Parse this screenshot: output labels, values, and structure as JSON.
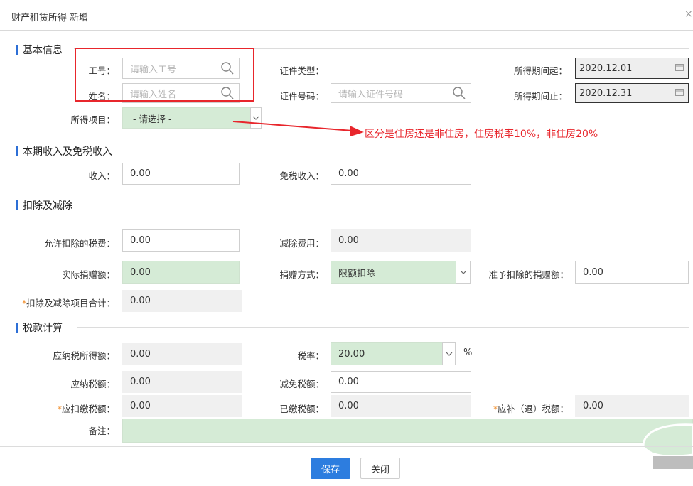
{
  "window": {
    "title": "财产租赁所得 新增",
    "close": "×"
  },
  "sections": {
    "basic": "基本信息",
    "income": "本期收入及免税收入",
    "deduction": "扣除及减除",
    "tax": "税款计算"
  },
  "basic": {
    "emp_no_label": "工号：",
    "emp_no_placeholder": "请输入工号",
    "name_label": "姓名：",
    "name_placeholder": "请输入姓名",
    "id_type_label": "证件类型：",
    "id_no_label": "证件号码：",
    "id_no_placeholder": "请输入证件号码",
    "period_start_label": "所得期间起：",
    "period_start_value": "2020.12.01",
    "period_end_label": "所得期间止：",
    "period_end_value": "2020.12.31",
    "item_label": "所得项目：",
    "item_value": "- 请选择 -"
  },
  "annotation": "区分是住房还是非住房，住房税率10%，非住房20%",
  "income": {
    "income_label": "收入：",
    "income_value": "0.00",
    "exempt_label": "免税收入：",
    "exempt_value": "0.00"
  },
  "deduction": {
    "allowed_tax_label": "允许扣除的税费：",
    "allowed_tax_value": "0.00",
    "reduce_fee_label": "减除费用：",
    "reduce_fee_value": "0.00",
    "donation_label": "实际捐赠额：",
    "donation_value": "0.00",
    "donation_method_label": "捐赠方式：",
    "donation_method_value": "限额扣除",
    "allowed_donation_label": "准予扣除的捐赠额：",
    "allowed_donation_value": "0.00",
    "total_label": "扣除及减除项目合计：",
    "total_value": "0.00"
  },
  "tax": {
    "taxable_income_label": "应纳税所得额：",
    "taxable_income_value": "0.00",
    "rate_label": "税率：",
    "rate_value": "20.00",
    "rate_unit": "%",
    "tax_payable_label": "应纳税额：",
    "tax_payable_value": "0.00",
    "relief_label": "减免税额：",
    "relief_value": "0.00",
    "withhold_label": "应扣缴税额：",
    "withhold_value": "0.00",
    "paid_label": "已缴税额：",
    "paid_value": "0.00",
    "refund_label": "应补（退）税额：",
    "refund_value": "0.00",
    "remark_label": "备注："
  },
  "buttons": {
    "save": "保存",
    "close": "关闭"
  },
  "colors": {
    "accent": "#2d7ddf",
    "highlight": "#d5ebd6",
    "annotation": "#e8262c",
    "required": "#f08a24"
  }
}
